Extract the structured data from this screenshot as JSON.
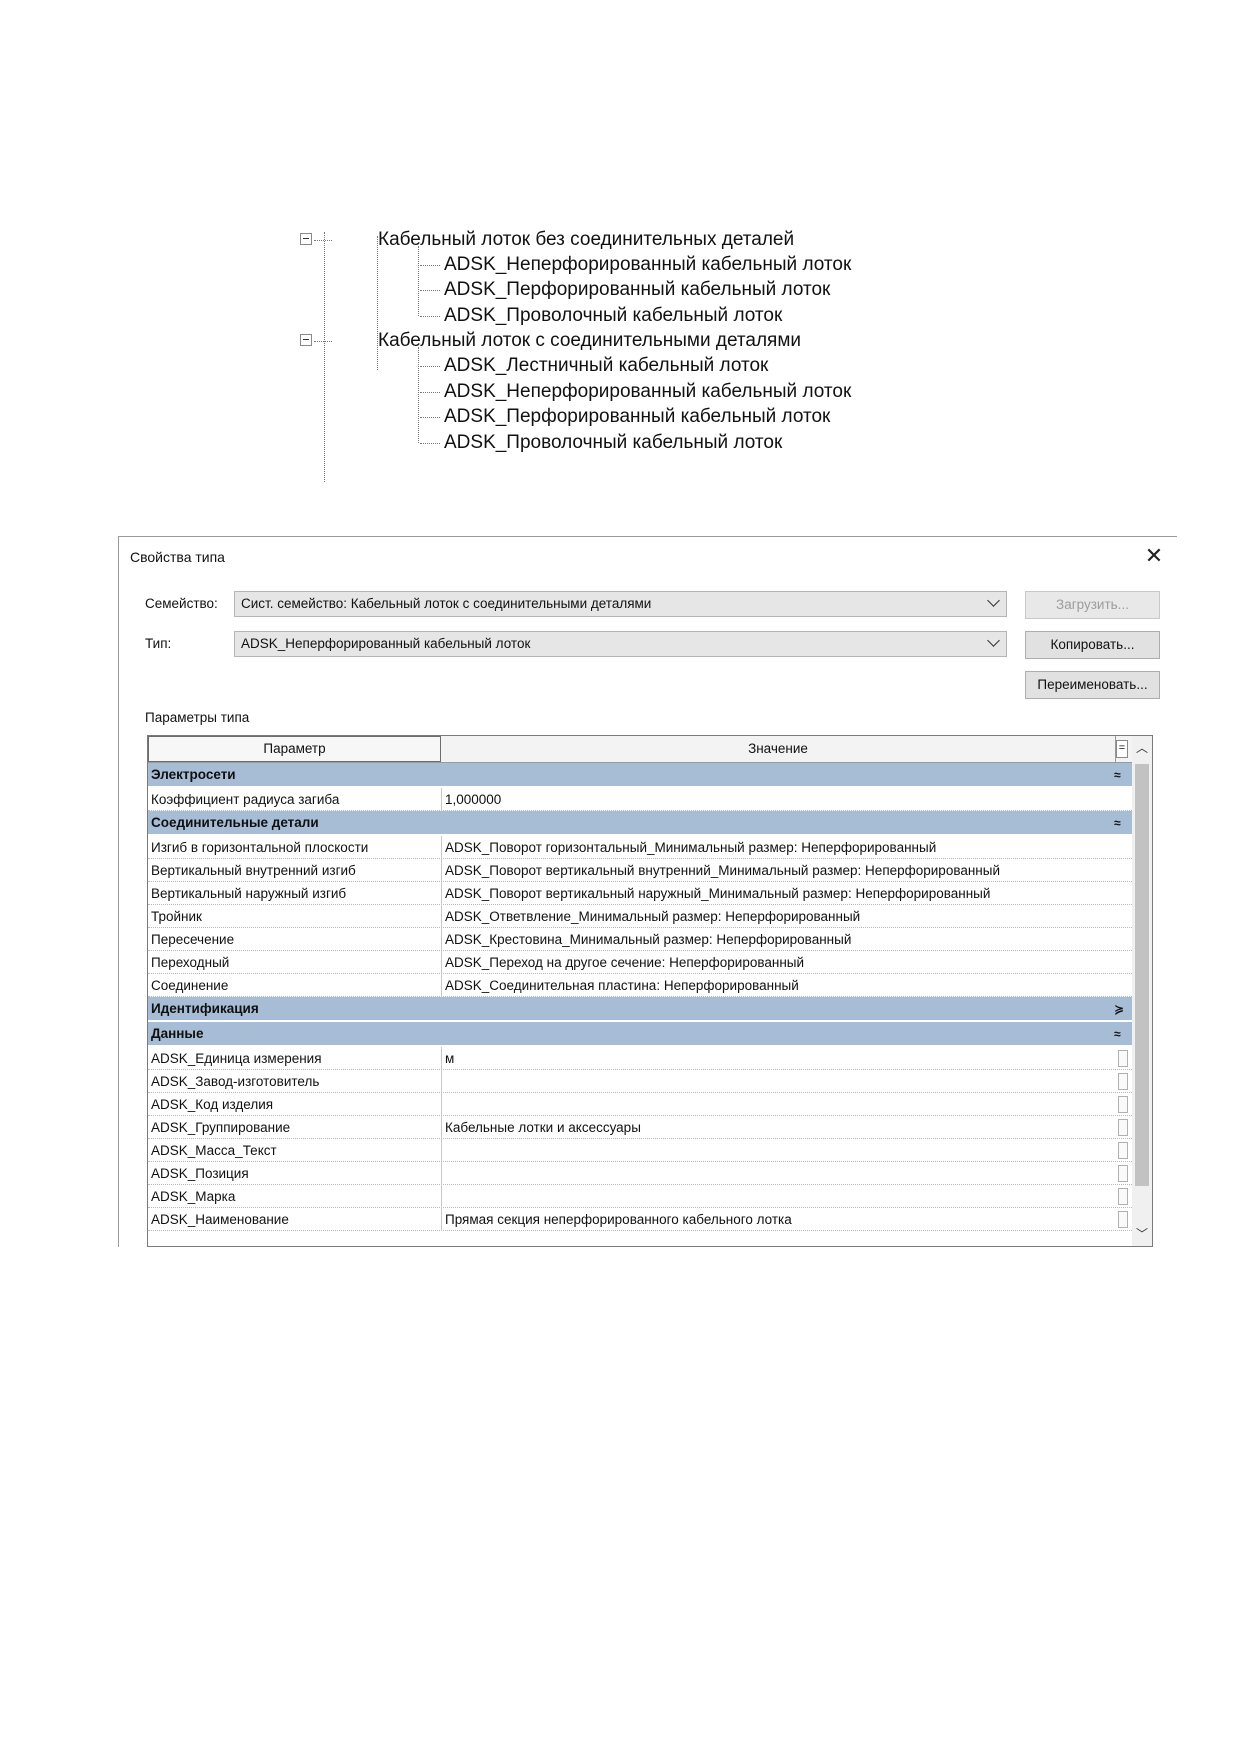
{
  "tree": {
    "groups": [
      {
        "label": "Кабельный лоток без соединительных деталей",
        "items": [
          "ADSK_Неперфорированный кабельный лоток",
          "ADSK_Перфорированный кабельный лоток",
          "ADSK_Проволочный кабельный лоток"
        ]
      },
      {
        "label": "Кабельный лоток с соединительными деталями",
        "items": [
          "ADSK_Лестничный кабельный лоток",
          "ADSK_Неперфорированный кабельный лоток",
          "ADSK_Перфорированный кабельный лоток",
          "ADSK_Проволочный кабельный лоток"
        ]
      }
    ]
  },
  "dialog": {
    "title": "Свойства типа",
    "close_glyph": "✕",
    "family_label": "Семейство:",
    "family_value": "Сист. семейство: Кабельный лоток с соединительными деталями",
    "type_label": "Тип:",
    "type_value": "ADSK_Неперфорированный кабельный лоток",
    "load_button": "Загрузить...",
    "copy_button": "Копировать...",
    "rename_button": "Переименовать...",
    "params_label": "Параметры типа",
    "grid": {
      "col_param": "Параметр",
      "col_value": "Значение",
      "eq_glyph": "=",
      "groups": [
        {
          "name": "Электросети",
          "toggle": "≈",
          "rows": [
            {
              "param": "Коэффициент радиуса загиба",
              "value": "1,000000"
            }
          ]
        },
        {
          "name": "Соединительные детали",
          "toggle": "≈",
          "rows": [
            {
              "param": "Изгиб в горизонтальной плоскости",
              "value": "ADSK_Поворот горизонтальный_Минимальный размер: Неперфорированный"
            },
            {
              "param": "Вертикальный внутренний изгиб",
              "value": "ADSK_Поворот вертикальный внутренний_Минимальный размер: Неперфорированный"
            },
            {
              "param": "Вертикальный наружный изгиб",
              "value": "ADSK_Поворот вертикальный наружный_Минимальный размер: Неперфорированный"
            },
            {
              "param": "Тройник",
              "value": "ADSK_Ответвление_Минимальный размер: Неперфорированный"
            },
            {
              "param": "Пересечение",
              "value": "ADSK_Крестовина_Минимальный размер: Неперфорированный"
            },
            {
              "param": "Переходный",
              "value": "ADSK_Переход на другое сечение: Неперфорированный"
            },
            {
              "param": "Соединение",
              "value": "ADSK_Соединительная пластина: Неперфорированный"
            }
          ]
        },
        {
          "name": "Идентификация",
          "toggle": "≽",
          "rows": []
        },
        {
          "name": "Данные",
          "toggle": "≈",
          "rows": [
            {
              "param": "ADSK_Единица измерения",
              "value": "м"
            },
            {
              "param": "ADSK_Завод-изготовитель",
              "value": ""
            },
            {
              "param": "ADSK_Код изделия",
              "value": ""
            },
            {
              "param": "ADSK_Группирование",
              "value": "Кабельные лотки и аксессуары"
            },
            {
              "param": "ADSK_Масса_Текст",
              "value": ""
            },
            {
              "param": "ADSK_Позиция",
              "value": ""
            },
            {
              "param": "ADSK_Марка",
              "value": ""
            },
            {
              "param": "ADSK_Наименование",
              "value": "Прямая секция неперфорированного кабельного лотка"
            }
          ]
        }
      ]
    }
  }
}
